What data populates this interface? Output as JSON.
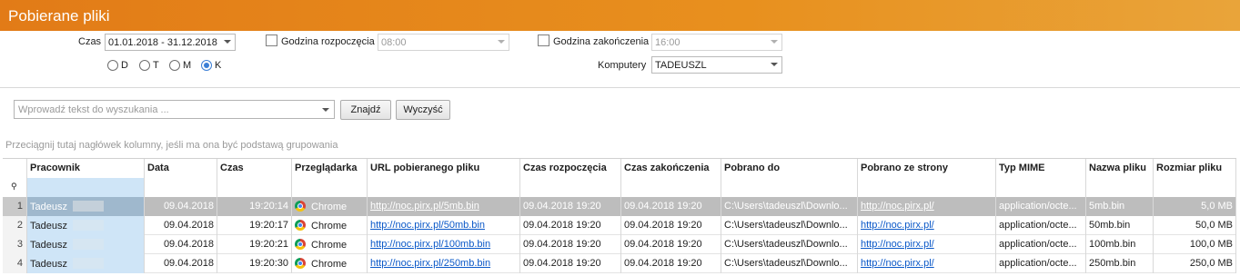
{
  "window": {
    "title": "Pobierane pliki"
  },
  "filters": {
    "czas_label": "Czas",
    "czas_value": "01.01.2018 - 31.12.2018",
    "godzina_rozpoczecia_label": "Godzina rozpoczęcia",
    "godzina_rozpoczecia_value": "08:00",
    "godzina_zakonczenia_label": "Godzina zakończenia",
    "godzina_zakonczenia_value": "16:00",
    "radios": [
      {
        "label": "D",
        "selected": false
      },
      {
        "label": "T",
        "selected": false
      },
      {
        "label": "M",
        "selected": false
      },
      {
        "label": "K",
        "selected": true
      }
    ],
    "komputery_label": "Komputery",
    "komputery_value": "TADEUSZL"
  },
  "search": {
    "placeholder": "Wprowadź tekst do wyszukania ...",
    "find_label": "Znajdź",
    "clear_label": "Wyczyść"
  },
  "group_hint": "Przeciągnij tutaj nagłówek kolumny, jeśli ma ona być podstawą grupowania",
  "filter_icon": "pin-icon",
  "columns": [
    "Pracownik",
    "Data",
    "Czas",
    "Przeglądarka",
    "URL pobieranego pliku",
    "Czas rozpoczęcia",
    "Czas zakończenia",
    "Pobrano do",
    "Pobrano ze strony",
    "Typ MIME",
    "Nazwa pliku",
    "Rozmiar pliku"
  ],
  "rows": [
    {
      "n": "1",
      "pracownik": "Tadeusz",
      "data": "09.04.2018",
      "czas": "19:20:14",
      "przegladarka": "Chrome",
      "url": "http://noc.pirx.pl/5mb.bin",
      "start": "09.04.2018 19:20",
      "end": "09.04.2018 19:20",
      "pobrano_do": "C:\\Users\\tadeuszl\\Downlo...",
      "strona": "http://noc.pirx.pl/",
      "mime": "application/octe...",
      "nazwa": "5mb.bin",
      "rozmiar": "5,0 MB"
    },
    {
      "n": "2",
      "pracownik": "Tadeusz",
      "data": "09.04.2018",
      "czas": "19:20:17",
      "przegladarka": "Chrome",
      "url": "http://noc.pirx.pl/50mb.bin",
      "start": "09.04.2018 19:20",
      "end": "09.04.2018 19:20",
      "pobrano_do": "C:\\Users\\tadeuszl\\Downlo...",
      "strona": "http://noc.pirx.pl/",
      "mime": "application/octe...",
      "nazwa": "50mb.bin",
      "rozmiar": "50,0 MB"
    },
    {
      "n": "3",
      "pracownik": "Tadeusz",
      "data": "09.04.2018",
      "czas": "19:20:21",
      "przegladarka": "Chrome",
      "url": "http://noc.pirx.pl/100mb.bin",
      "start": "09.04.2018 19:20",
      "end": "09.04.2018 19:20",
      "pobrano_do": "C:\\Users\\tadeuszl\\Downlo...",
      "strona": "http://noc.pirx.pl/",
      "mime": "application/octe...",
      "nazwa": "100mb.bin",
      "rozmiar": "100,0 MB"
    },
    {
      "n": "4",
      "pracownik": "Tadeusz",
      "data": "09.04.2018",
      "czas": "19:20:30",
      "przegladarka": "Chrome",
      "url": "http://noc.pirx.pl/250mb.bin",
      "start": "09.04.2018 19:20",
      "end": "09.04.2018 19:20",
      "pobrano_do": "C:\\Users\\tadeuszl\\Downlo...",
      "strona": "http://noc.pirx.pl/",
      "mime": "application/octe...",
      "nazwa": "250mb.bin",
      "rozmiar": "250,0 MB"
    }
  ]
}
